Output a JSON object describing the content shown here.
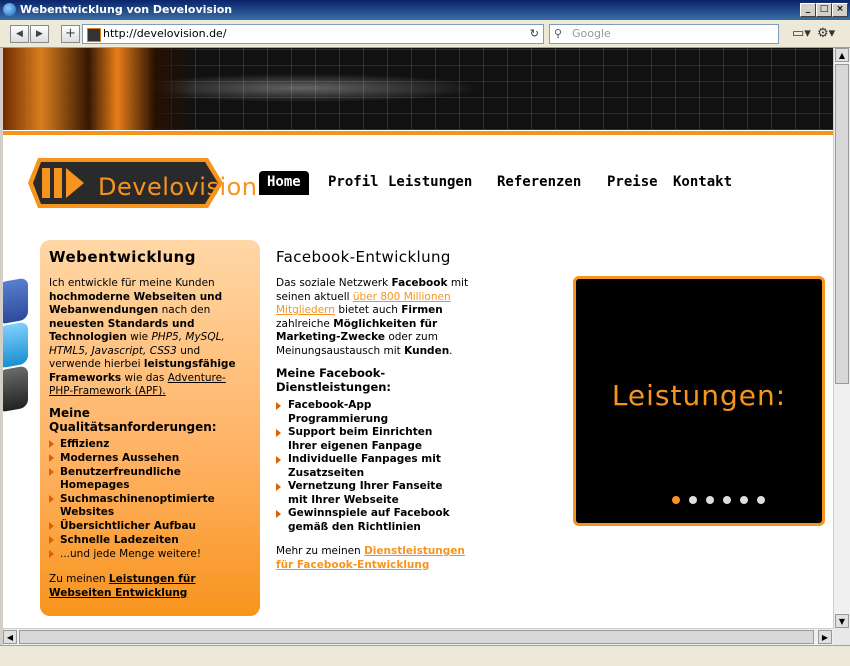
{
  "window": {
    "title": "Webentwicklung von Develovision"
  },
  "browser": {
    "url": "http://develovision.de/",
    "search_placeholder": "Google"
  },
  "site": {
    "logo_text": "Develovision",
    "nav": [
      {
        "label": "Home",
        "active": true
      },
      {
        "label": "Profil"
      },
      {
        "label": "Leistungen"
      },
      {
        "label": "Referenzen"
      },
      {
        "label": "Preise"
      },
      {
        "label": "Kontakt"
      }
    ]
  },
  "left": {
    "heading": "Webentwicklung",
    "p1": [
      "Ich entwickle für meine Kunden",
      "hochmoderne Webseiten und",
      "Webanwendungen",
      "nach den",
      "neuesten Standards und",
      "Technologien",
      "wie",
      "PHP5, MySQL,",
      "HTML5, Javascript, CSS3",
      "und",
      "verwende hierbei",
      "leistungsfähige",
      "Frameworks",
      "wie das",
      "Adventure-",
      "PHP-Framework (APF)."
    ],
    "q_heading": [
      "Meine",
      "Qualitätsanforderungen:"
    ],
    "qualities": [
      "Effizienz",
      "Modernes Aussehen",
      "Benutzerfreundliche Homepages",
      "Suchmaschinenoptimierte Websites",
      "Übersichtlicher Aufbau",
      "Schnelle Ladezeiten",
      "...und jede Menge weitere!"
    ],
    "footer_prefix": "Zu meinen",
    "footer_link1": "Leistungen für",
    "footer_link2": "Webseiten Entwicklung"
  },
  "middle": {
    "title": "Facebook-Entwicklung",
    "intro": {
      "t1": "Das soziale Netzwerk",
      "b1": "Facebook",
      "t2": "mit",
      "t3": "seinen aktuell",
      "link1": "über 800 Millionen",
      "link2": "Mitgliedern",
      "t4": "bietet auch",
      "b2": "Firmen",
      "t5": "zahlreiche",
      "b3": "Möglichkeiten für",
      "b4": "Marketing-Zwecke",
      "t6": "oder zum",
      "t7": "Meinungsaustausch mit",
      "b5": "Kunden",
      "t8": "."
    },
    "sub_heading": [
      "Meine Facebook-",
      "Dienstleistungen:"
    ],
    "services": [
      [
        "Facebook-App",
        "Programmierung"
      ],
      [
        "Support beim Einrichten",
        "Ihrer eigenen Fanpage"
      ],
      [
        "Individuelle Fanpages mit",
        "Zusatzseiten"
      ],
      [
        "Vernetzung Ihrer Fanseite",
        "mit Ihrer Webseite"
      ],
      [
        "Gewinnspiele auf Facebook",
        "gemäß den Richtlinien"
      ]
    ],
    "more_prefix": "Mehr zu meinen",
    "more_link1": "Dienstleistungen",
    "more_link2": "für Facebook-Entwicklung"
  },
  "slider": {
    "text": "Leistungen:",
    "dots": 6,
    "active_dot": 1
  },
  "colors": {
    "accent": "#f7941d",
    "nav_active_bg": "#000000"
  }
}
